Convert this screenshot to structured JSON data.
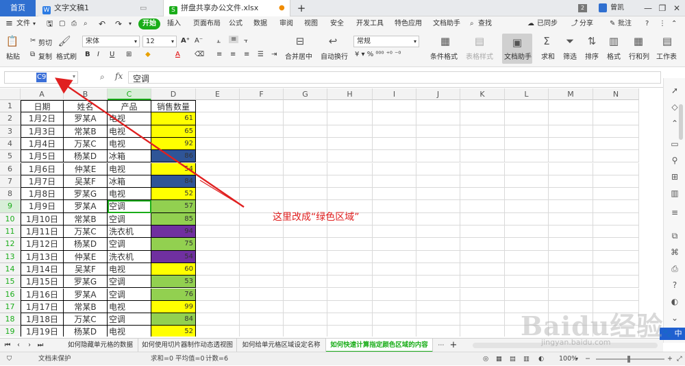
{
  "titlebar": {
    "tabs": [
      {
        "label": "首页",
        "icon": "home"
      },
      {
        "label": "文字文稿1",
        "icon": "wps-writer-icon"
      },
      {
        "label": "拼盘共享办公文件.xlsx",
        "icon": "wps-sheet-icon"
      }
    ],
    "new_tab": "+",
    "page_count": "2",
    "user": "曾凯"
  },
  "menubar": {
    "file": "文件",
    "start": "开始",
    "items": [
      "插入",
      "页面布局",
      "公式",
      "数据",
      "审阅",
      "视图",
      "安全",
      "开发工具",
      "特色应用",
      "文档助手"
    ],
    "search": "查找",
    "sync": "已同步",
    "share": "分享",
    "comment": "批注"
  },
  "ribbon": {
    "paste": "粘贴",
    "cut": "剪切",
    "copy": "复制",
    "format_painter": "格式刷",
    "font_name": "宋体",
    "font_size": "12",
    "merge": "合并居中",
    "wrap": "自动换行",
    "number_format": "常规",
    "conditional_format": "条件格式",
    "table_style": "表格样式",
    "doc_helper": "文档助手",
    "sum": "求和",
    "filter": "筛选",
    "sort": "排序",
    "format": "格式",
    "rows_cols": "行和列",
    "worksheet": "工作表"
  },
  "formula_bar": {
    "name_box": "C9",
    "fx": "fx",
    "value": "空调"
  },
  "columns": [
    "A",
    "B",
    "C",
    "D",
    "E",
    "F",
    "G",
    "H",
    "I",
    "J",
    "K",
    "L",
    "M",
    "N"
  ],
  "row_numbers": [
    "1",
    "2",
    "3",
    "4",
    "5",
    "6",
    "7",
    "8",
    "9",
    "10",
    "11",
    "12",
    "13",
    "14",
    "15",
    "16",
    "17",
    "18",
    "19"
  ],
  "header_row": [
    "日期",
    "姓名",
    "产品",
    "销售数量"
  ],
  "rows": [
    [
      "1月2日",
      "罗某A",
      "电视",
      "61"
    ],
    [
      "1月3日",
      "常某B",
      "电视",
      "65"
    ],
    [
      "1月4日",
      "万某C",
      "电视",
      "92"
    ],
    [
      "1月5日",
      "杨某D",
      "冰箱",
      "86"
    ],
    [
      "1月6日",
      "仲某E",
      "电视",
      "54"
    ],
    [
      "1月7日",
      "吴某F",
      "冰箱",
      "84"
    ],
    [
      "1月8日",
      "罗某G",
      "电视",
      "52"
    ],
    [
      "1月9日",
      "罗某A",
      "空调",
      "57"
    ],
    [
      "1月10日",
      "常某B",
      "空调",
      "85"
    ],
    [
      "1月11日",
      "万某C",
      "洗衣机",
      "94"
    ],
    [
      "1月12日",
      "杨某D",
      "空调",
      "75"
    ],
    [
      "1月13日",
      "仲某E",
      "洗衣机",
      "54"
    ],
    [
      "1月14日",
      "吴某F",
      "电视",
      "60"
    ],
    [
      "1月15日",
      "罗某G",
      "空调",
      "53"
    ],
    [
      "1月16日",
      "罗某A",
      "空调",
      "76"
    ],
    [
      "1月17日",
      "常某B",
      "电视",
      "99"
    ],
    [
      "1月18日",
      "万某C",
      "空调",
      "84"
    ],
    [
      "1月19日",
      "杨某D",
      "电视",
      "52"
    ]
  ],
  "fill_colors": {
    "电视": "#ffff00",
    "冰箱": "#2f5597",
    "空调": "#92d050",
    "洗衣机": "#7030a0"
  },
  "annotation": "这里改成“绿色区域”",
  "sheet_tabs": [
    "如何隐藏单元格的数据",
    "如何使用切片器制作动态透视图",
    "如何给单元格区域设定名称",
    "如何快速计算指定颜色区域的内容"
  ],
  "active_sheet": 3,
  "status": {
    "protect": "文档未保护",
    "sum": "求和=0",
    "avg": "平均值=0",
    "count": "计数=6",
    "zoom": "100%"
  },
  "watermark": {
    "main": "Baidu经验",
    "sub": "jingyan.baidu.com"
  },
  "accent": "#1aad19"
}
